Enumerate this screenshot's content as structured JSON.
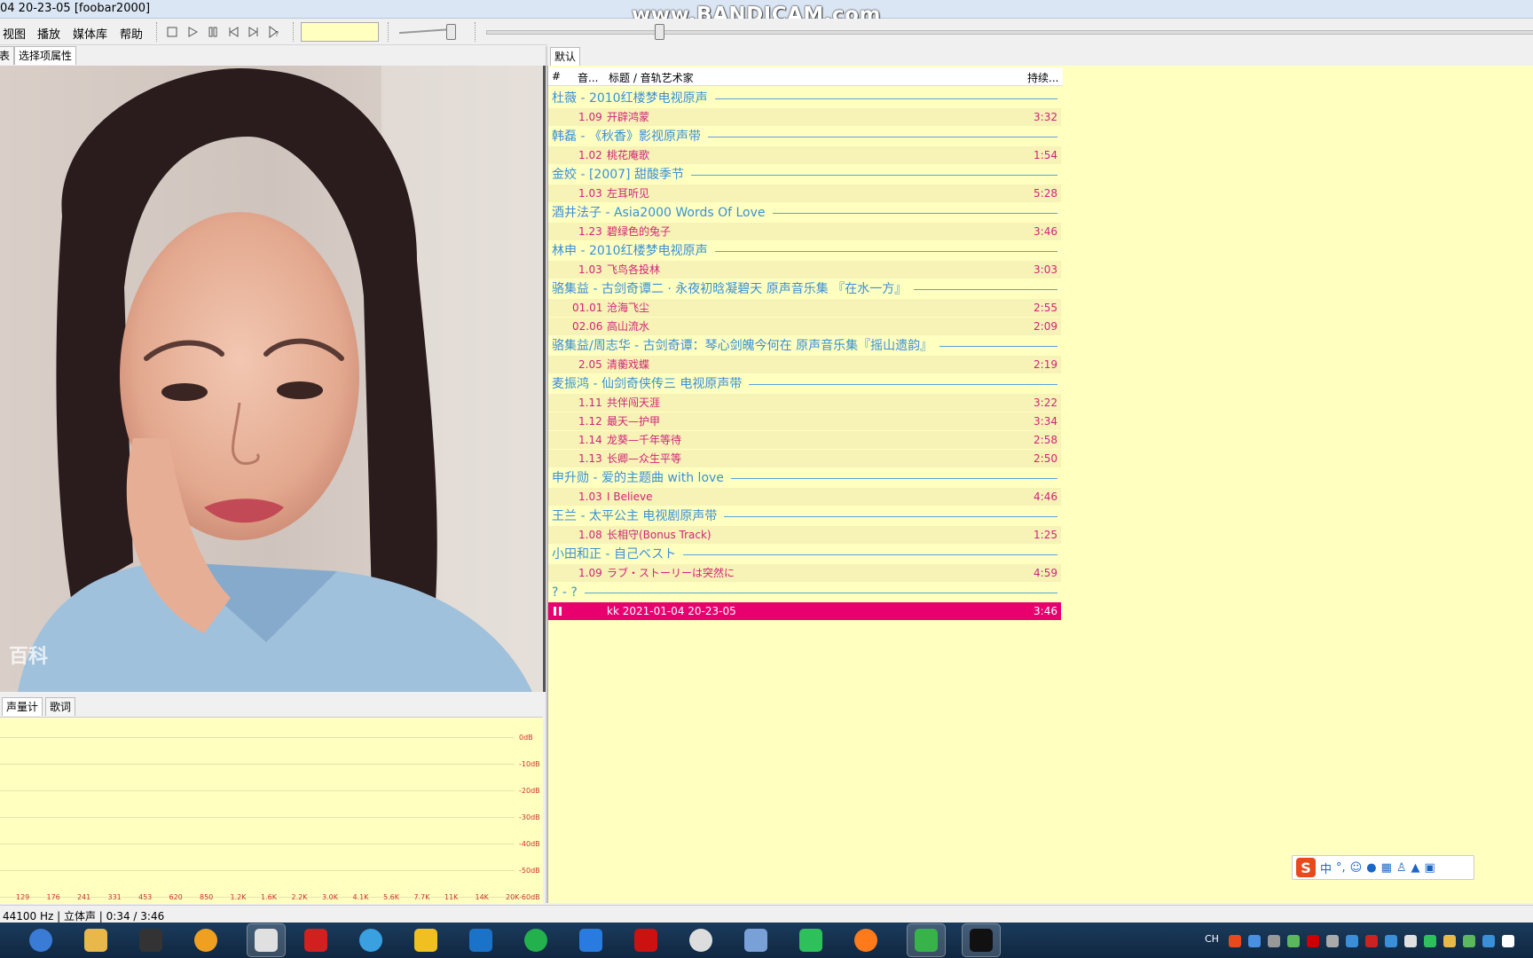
{
  "window": {
    "title": "04 20-23-05  [foobar2000]",
    "watermark": "www.BANDICAM.com"
  },
  "menu": {
    "items": [
      "视图",
      "播放",
      "媒体库",
      "帮助"
    ]
  },
  "left_tabs": {
    "tab1": "表",
    "tab2": "选择项属性"
  },
  "viz_tabs": {
    "tab1": "声量计",
    "tab2": "歌词"
  },
  "viz": {
    "db_labels": [
      "0dB",
      "-10dB",
      "-20dB",
      "-30dB",
      "-40dB",
      "-50dB",
      "-60dB"
    ],
    "freq_labels": [
      "129",
      "176",
      "241",
      "331",
      "453",
      "620",
      "850",
      "1.2K",
      "1.6K",
      "2.2K",
      "3.0K",
      "4.1K",
      "5.6K",
      "7.7K",
      "11K",
      "14K",
      "20K"
    ]
  },
  "art": {
    "watermark": "百科"
  },
  "playlist": {
    "tab": "默认",
    "headers": {
      "col1": "#",
      "col2": "音...",
      "col3": "标题 / 音轨艺术家",
      "col4": "持续..."
    },
    "groups": [
      {
        "label": "杜薇 - 2010红楼梦电视原声",
        "tracks": [
          {
            "num": "1.09",
            "title": "开辟鸿蒙",
            "dur": "3:32"
          }
        ]
      },
      {
        "label": "韩磊 - 《秋香》影视原声带",
        "tracks": [
          {
            "num": "1.02",
            "title": "桃花庵歌",
            "dur": "1:54"
          }
        ]
      },
      {
        "label": "金姣 - [2007] 甜酸季节",
        "tracks": [
          {
            "num": "1.03",
            "title": "左耳听见",
            "dur": "5:28"
          }
        ]
      },
      {
        "label": "酒井法子 - Asia2000 Words Of Love",
        "tracks": [
          {
            "num": "1.23",
            "title": "碧绿色的兔子",
            "dur": "3:46"
          }
        ]
      },
      {
        "label": "林申 - 2010红楼梦电视原声",
        "tracks": [
          {
            "num": "1.03",
            "title": "飞鸟各投林",
            "dur": "3:03"
          }
        ]
      },
      {
        "label": "骆集益 - 古剑奇谭二 · 永夜初晗凝碧天 原声音乐集 『在水一方』",
        "tracks": [
          {
            "num": "01.01",
            "title": "沧海飞尘",
            "dur": "2:55"
          },
          {
            "num": "02.06",
            "title": "高山流水",
            "dur": "2:09"
          }
        ]
      },
      {
        "label": "骆集益/周志华 - 古剑奇谭：琴心剑魄今何在 原声音乐集『摇山遗韵』",
        "tracks": [
          {
            "num": "2.05",
            "title": "清蘅戏蝶",
            "dur": "2:19"
          }
        ]
      },
      {
        "label": "麦振鸿 - 仙剑奇侠传三 电视原声带",
        "tracks": [
          {
            "num": "1.11",
            "title": "共伴闯天涯",
            "dur": "3:22"
          },
          {
            "num": "1.12",
            "title": "最天—护甲",
            "dur": "3:34"
          },
          {
            "num": "1.14",
            "title": "龙葵—千年等待",
            "dur": "2:58"
          },
          {
            "num": "1.13",
            "title": "长卿—众生平等",
            "dur": "2:50"
          }
        ]
      },
      {
        "label": "申升勋 - 爱的主题曲 with love",
        "tracks": [
          {
            "num": "1.03",
            "title": "I Believe",
            "dur": "4:46"
          }
        ]
      },
      {
        "label": "王兰 - 太平公主 电视剧原声带",
        "tracks": [
          {
            "num": "1.08",
            "title": "长相守(Bonus Track)",
            "dur": "1:25"
          }
        ]
      },
      {
        "label": "小田和正 - 自己ベスト",
        "tracks": [
          {
            "num": "1.09",
            "title": "ラブ・ストーリーは突然に",
            "dur": "4:59"
          }
        ]
      },
      {
        "label": "? - ?",
        "tracks": [
          {
            "num": "",
            "title": "kk 2021-01-04 20-23-05",
            "dur": "3:46",
            "playing": true
          }
        ]
      }
    ]
  },
  "ime": {
    "logo": "S",
    "mode": "中",
    "punct": "°,"
  },
  "status": {
    "text": "44100 Hz | 立体声 | 0:34 / 3:46"
  },
  "tray": {
    "lang": "CH"
  },
  "taskbar": {
    "items": [
      "search-icon",
      "file-explorer-icon",
      "media-player-321-icon",
      "headphones-icon",
      "alien-app-icon",
      "netease-music-icon",
      "browser-icon",
      "player-icon",
      "app-1-icon",
      "iqiyi-icon",
      "youku-icon",
      "flash-icon",
      "chrome-icon",
      "feather-icon",
      "play-store-icon",
      "firefox-icon",
      "360-browser-icon",
      "bandicam-record-icon"
    ]
  },
  "colors": {
    "playlist_bg": "#ffffc0",
    "group_blue": "#3a8fd8",
    "track_pink": "#d0247a",
    "playing_bg": "#e8006f"
  }
}
